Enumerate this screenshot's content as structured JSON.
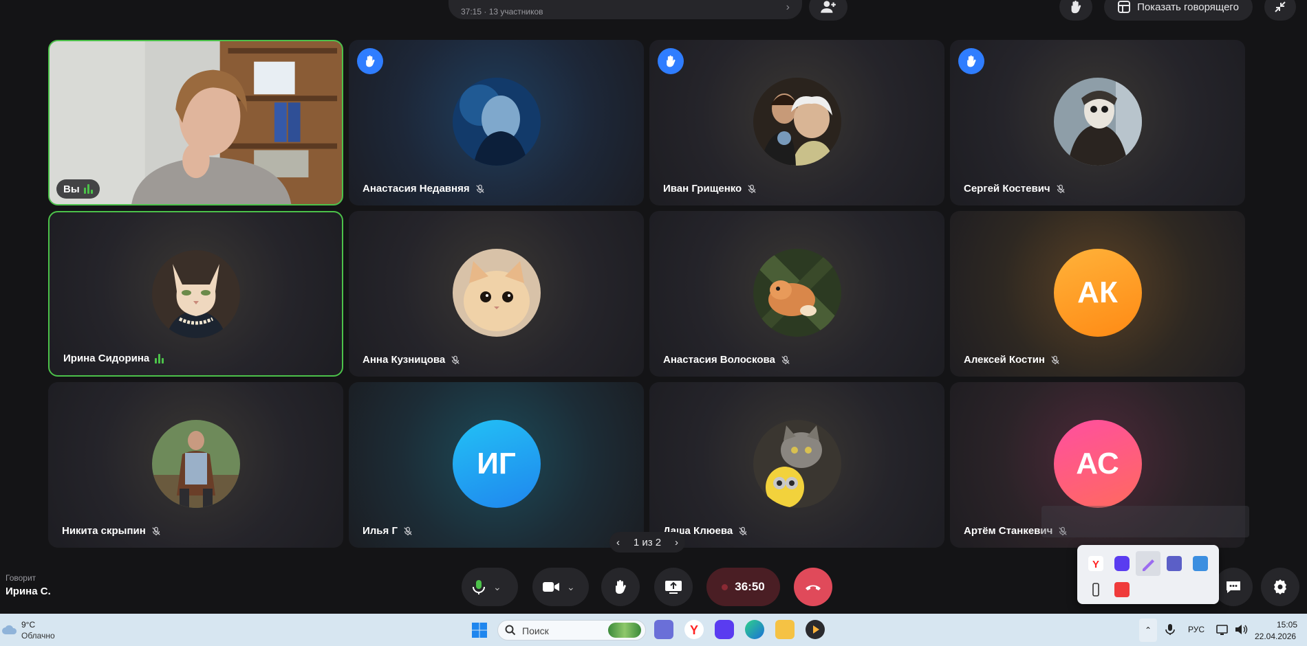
{
  "header": {
    "meeting_meta": "37:15 · 13 участников",
    "show_speaker_label": "Показать говорящего"
  },
  "tiles": [
    {
      "name": "Вы",
      "self": true
    },
    {
      "name": "Анастасия Недавняя",
      "hand_raised": true
    },
    {
      "name": "Иван Грищенко",
      "hand_raised": true
    },
    {
      "name": "Сергей Костевич",
      "hand_raised": true
    },
    {
      "name": "Ирина Сидорина",
      "speaking": true
    },
    {
      "name": "Анна Кузницова"
    },
    {
      "name": "Анастасия Волоскова"
    },
    {
      "name": "Алексей Костин",
      "initials": "АК"
    },
    {
      "name": "Никита скрыпин"
    },
    {
      "name": "Илья Г",
      "initials": "ИГ"
    },
    {
      "name": "Даша Клюева"
    },
    {
      "name": "Артём Станкевич",
      "initials": "АС"
    }
  ],
  "pagination": {
    "label": "1 из 2"
  },
  "speaking": {
    "label": "Говорит",
    "name": "Ирина С."
  },
  "controls": {
    "timer": "36:50"
  },
  "colors": {
    "accent_blue": "#2f7dff",
    "active_border": "#4cc24a",
    "end_call": "#e04a5a",
    "avatar_ak": "#ff9a1f",
    "avatar_ig": "#1f9ff2",
    "avatar_as": "#ff4f8b"
  },
  "taskbar": {
    "weather_temp": "9°C",
    "weather_desc": "Облачно",
    "search_placeholder": "Поиск",
    "language": "РУС",
    "time": "15:05",
    "date": "22.04.2026"
  }
}
